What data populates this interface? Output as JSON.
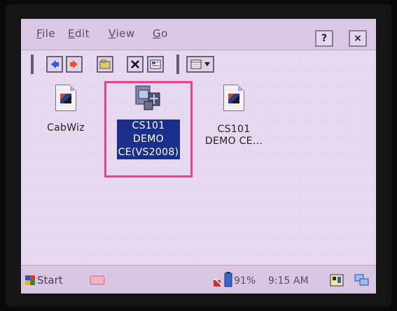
{
  "menu": {
    "file": "File",
    "edit": "Edit",
    "view": "View",
    "go": "Go",
    "help_label": "?",
    "close_label": "×"
  },
  "toolbar": {
    "back_icon": "back-arrow-icon",
    "forward_icon": "forward-arrow-icon",
    "up_icon": "up-folder-icon",
    "delete_icon": "delete-x-icon",
    "properties_icon": "properties-icon",
    "views_icon": "view-mode-icon"
  },
  "files": [
    {
      "label": "CabWiz",
      "icon": "cab-setup-icon",
      "selected": false
    },
    {
      "label_lines": [
        "CS101",
        "DEMO",
        "CE(VS2008)"
      ],
      "icon": "solution-icon",
      "selected": true
    },
    {
      "label_lines": [
        "CS101",
        "DEMO CE..."
      ],
      "icon": "cab-setup-icon",
      "selected": false
    }
  ],
  "taskbar": {
    "start_label": "Start",
    "battery": "91%",
    "time": "9:15 AM"
  },
  "colors": {
    "desktop": "#e7d9ef",
    "selection": "#1b2f8a",
    "highlight_border": "#e2458c"
  }
}
